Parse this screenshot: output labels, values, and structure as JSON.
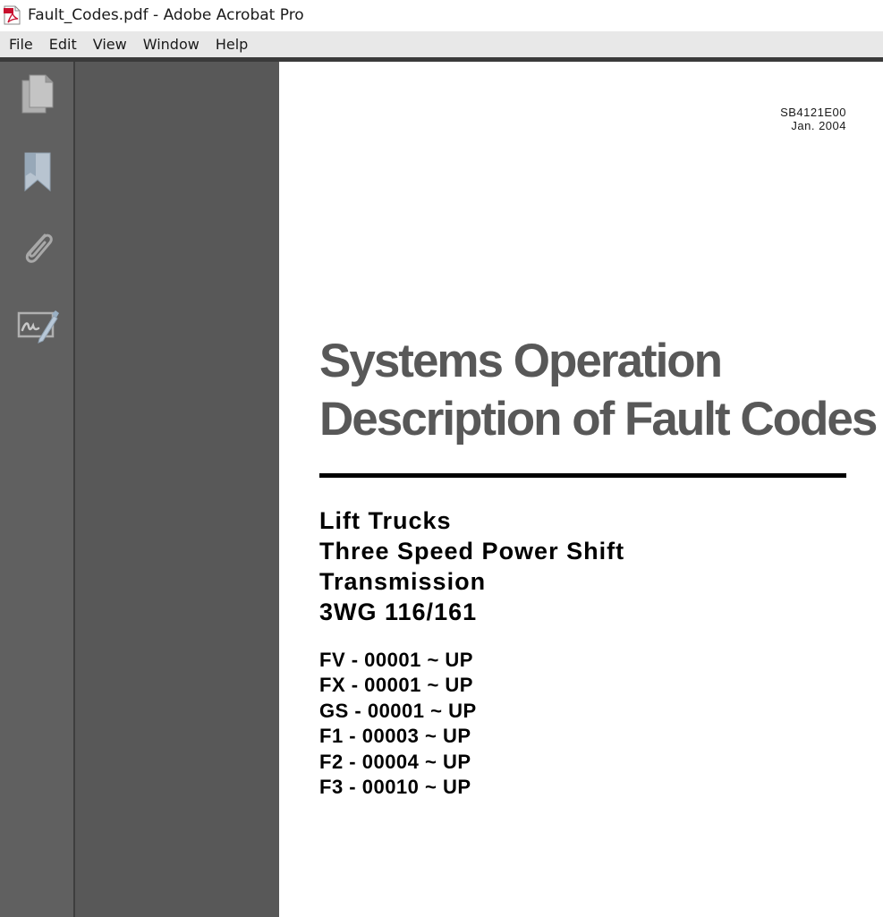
{
  "window": {
    "title": "Fault_Codes.pdf - Adobe Acrobat Pro",
    "icon": "pdf-file-icon"
  },
  "menu": {
    "items": [
      "File",
      "Edit",
      "View",
      "Window",
      "Help"
    ]
  },
  "nav_pane": {
    "buttons": [
      {
        "icon": "page-thumbnails-icon"
      },
      {
        "icon": "bookmark-icon"
      },
      {
        "icon": "attachment-paperclip-icon"
      },
      {
        "icon": "signature-icon"
      }
    ]
  },
  "document": {
    "code": "SB4121E00",
    "date": "Jan. 2004",
    "title_lines": [
      "Systems Operation",
      "Description of Fault Codes"
    ],
    "subtitle_lines": [
      "Lift Trucks",
      "Three Speed Power Shift",
      "Transmission",
      "3WG 116/161"
    ],
    "serial_ranges": [
      "FV - 00001 ~ UP",
      "FX - 00001 ~ UP",
      "GS - 00001 ~ UP",
      "F1 - 00003 ~ UP",
      "F2 - 00004 ~ UP",
      "F3 - 00010 ~ UP"
    ]
  },
  "colors": {
    "title_gray": "#585858",
    "nav_pane": "#606060",
    "doc_background": "#585858",
    "menubar": "#e8e8e8",
    "pdf_red": "#c8102e"
  }
}
